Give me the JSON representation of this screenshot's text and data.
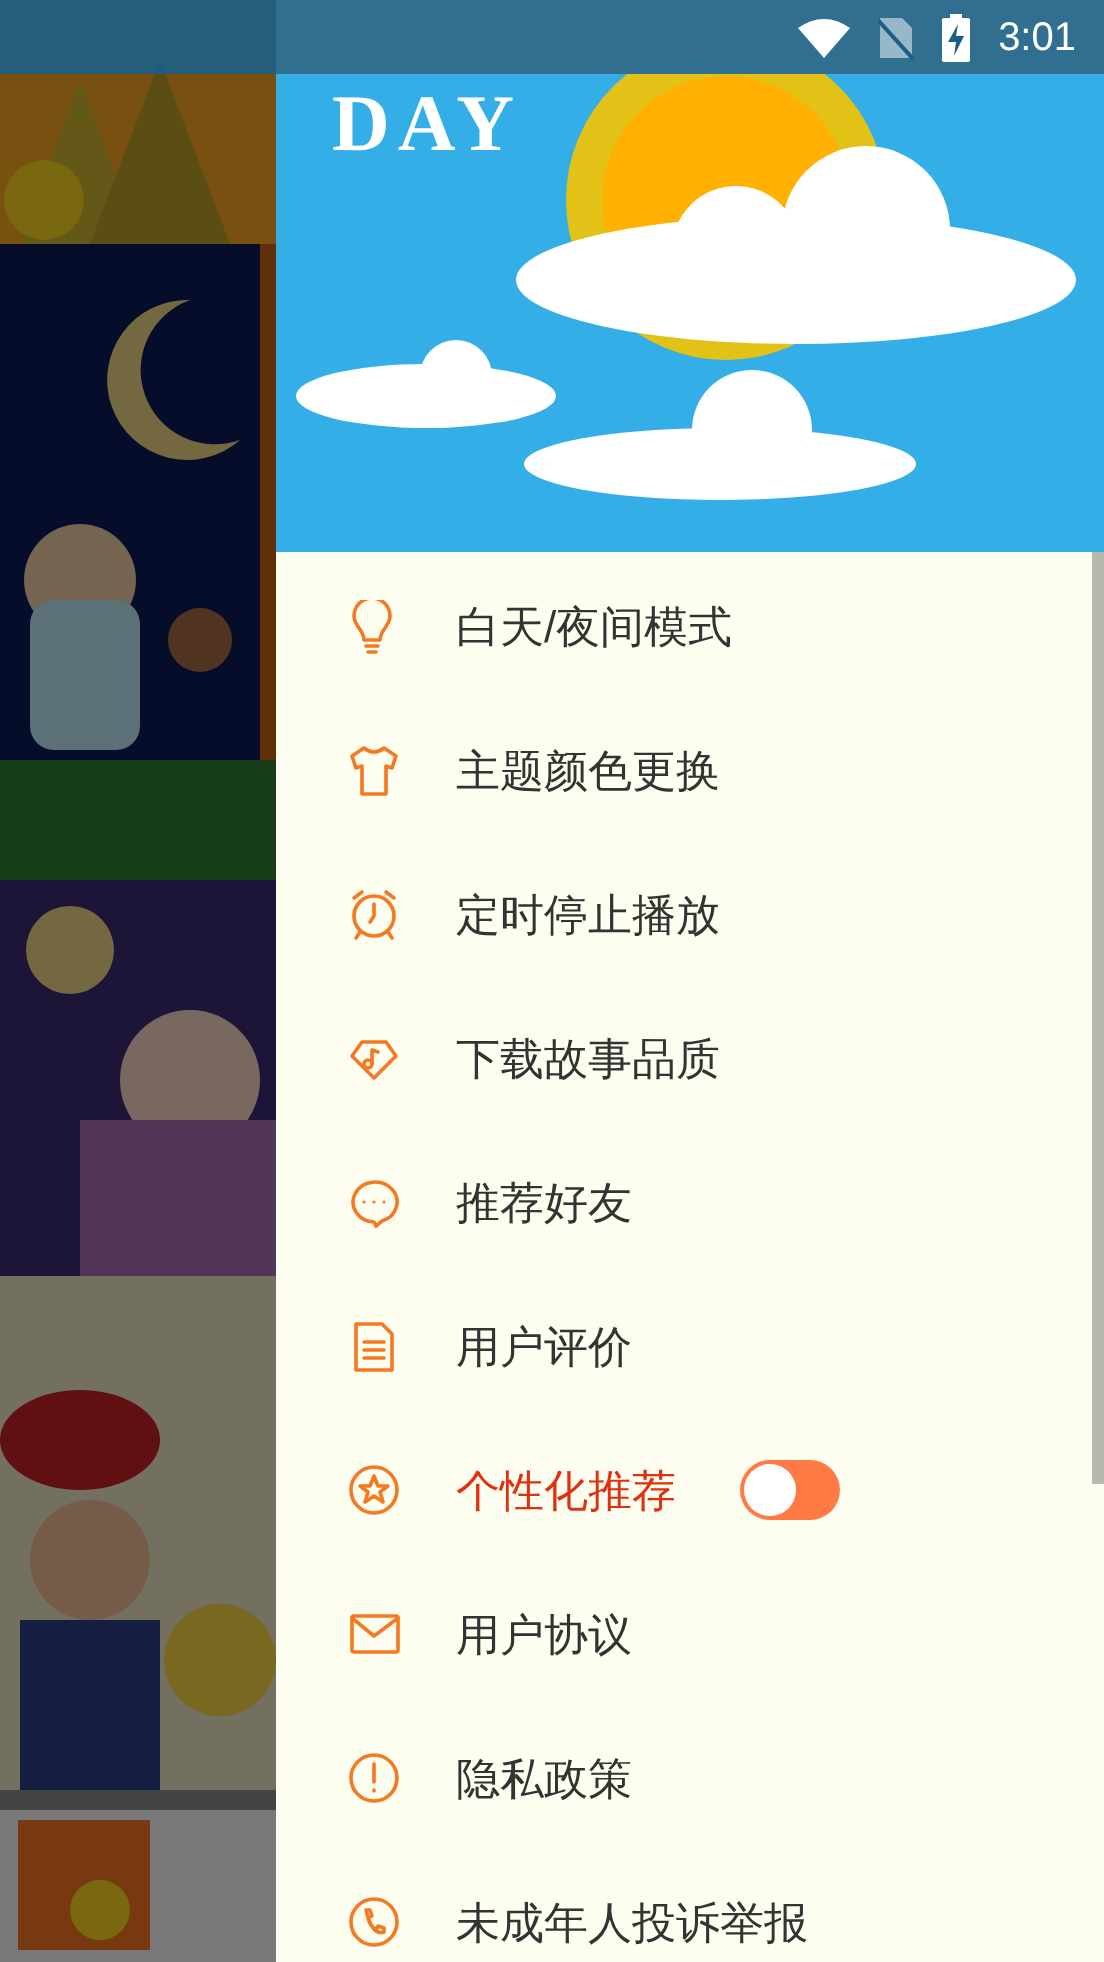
{
  "status_bar": {
    "time": "3:01"
  },
  "drawer": {
    "header": {
      "title": "DAY"
    },
    "items": [
      {
        "kind": "link",
        "label": "白天/夜间模式"
      },
      {
        "kind": "link",
        "label": "主题颜色更换"
      },
      {
        "kind": "link",
        "label": "定时停止播放"
      },
      {
        "kind": "link",
        "label": "下载故事品质"
      },
      {
        "kind": "link",
        "label": "推荐好友"
      },
      {
        "kind": "link",
        "label": "用户评价"
      },
      {
        "kind": "toggle",
        "label": "个性化推荐",
        "on": false
      },
      {
        "kind": "link",
        "label": "用户协议"
      },
      {
        "kind": "link",
        "label": "隐私政策"
      },
      {
        "kind": "link",
        "label": "未成年人投诉举报"
      }
    ]
  }
}
